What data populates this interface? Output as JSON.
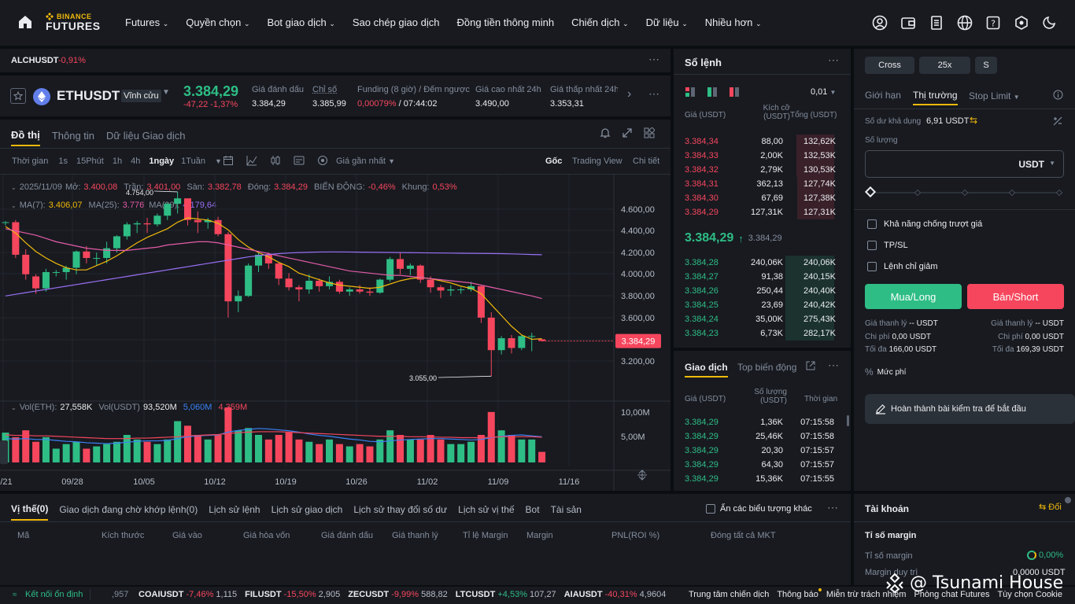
{
  "header": {
    "brand_top": "BINANCE",
    "brand_bottom": "FUTURES",
    "nav": [
      "Futures",
      "Quyền chọn",
      "Bot giao dịch",
      "Sao chép giao dịch",
      "Đồng tiền thông minh",
      "Chiến dịch",
      "Dữ liệu",
      "Nhiều hơn"
    ]
  },
  "ticker_strip": {
    "symbol": "ALCHUSDT",
    "change": "-0,91%"
  },
  "symbol_bar": {
    "symbol": "ETHUSDT",
    "type": "Vĩnh cửu",
    "price": "3.384,29",
    "change": "-47,22 -1,37%",
    "stats": [
      {
        "label": "Giá đánh dấu",
        "value": "3.384,29"
      },
      {
        "label": "Chỉ số",
        "value": "3.385,99"
      },
      {
        "label": "Funding (8 giờ) / Đếm ngược",
        "value_red": "0,00079%",
        "value_rest": " / 07:44:02"
      },
      {
        "label": "Giá cao nhất 24h",
        "value": "3.490,00"
      },
      {
        "label": "Giá thấp nhất 24h",
        "value": "3.353,31"
      }
    ]
  },
  "chart_tabs": [
    "Đồ thị",
    "Thông tin",
    "Dữ liệu Giao dịch"
  ],
  "chart_toolbar": {
    "time_label": "Thời gian",
    "intervals": [
      "1s",
      "15Phút",
      "1h",
      "4h",
      "1ngày",
      "1Tuần"
    ],
    "price_type": "Giá gần nhất",
    "views": [
      "Gốc",
      "Trading View",
      "Chi tiết"
    ]
  },
  "ohlc": {
    "date": "2025/11/09",
    "open_label": "Mở:",
    "open": "3.400,08",
    "high_label": "Trần:",
    "high": "3.401,00",
    "low_label": "Sàn:",
    "low": "3.382,78",
    "close_label": "Đóng:",
    "close": "3.384,29",
    "change_label": "BIẾN ĐỘNG:",
    "change": "-0,46%",
    "range_label": "Khung:",
    "range": "0,53%"
  },
  "ma": {
    "ma7_label": "MA(7):",
    "ma7": "3.406,07",
    "ma25_label": "MA(25):",
    "ma25": "3.776",
    "ma99_label": "MA(99):",
    "ma99": "4.179,64"
  },
  "vol": {
    "label": "Vol(ETH):",
    "eth": "27,558K",
    "usdt_label": "Vol(USDT)",
    "usdt": "93,520M",
    "v1": "5,060M",
    "v2": "4,359M"
  },
  "chart_data": {
    "type": "candlestick",
    "y_ticks": [
      "4.600,00",
      "4.400,00",
      "4.200,00",
      "4.000,00",
      "3.800,00",
      "3.600,00",
      "3.400,00",
      "3.200,00"
    ],
    "vol_ticks": [
      "10,00M",
      "5,00M"
    ],
    "x_ticks": [
      "/21",
      "09/28",
      "10/05",
      "10/12",
      "10/19",
      "10/26",
      "11/02",
      "11/09",
      "11/16"
    ],
    "last_price": "3.384,29",
    "high_marker": "4.754,00",
    "low_marker": "3.055,00",
    "candles": [
      [
        4480,
        4490,
        4450,
        4480
      ],
      [
        4480,
        4500,
        4150,
        4180
      ],
      [
        4180,
        4230,
        3950,
        4000
      ],
      [
        3980,
        4000,
        3820,
        3870
      ],
      [
        3870,
        4050,
        3840,
        4020
      ],
      [
        4020,
        4040,
        3980,
        4020
      ],
      [
        4020,
        4080,
        3950,
        4060
      ],
      [
        4060,
        4220,
        4000,
        4210
      ],
      [
        4210,
        4260,
        4100,
        4150
      ],
      [
        4150,
        4200,
        4080,
        4150
      ],
      [
        4150,
        4300,
        4100,
        4240
      ],
      [
        4240,
        4360,
        4200,
        4350
      ],
      [
        4350,
        4480,
        4320,
        4460
      ],
      [
        4460,
        4490,
        4380,
        4470
      ],
      [
        4470,
        4520,
        4380,
        4460
      ],
      [
        4460,
        4560,
        4440,
        4540
      ],
      [
        4540,
        4660,
        4500,
        4650
      ],
      [
        4650,
        4760,
        4560,
        4700
      ],
      [
        4700,
        4700,
        4450,
        4500
      ],
      [
        4500,
        4580,
        4380,
        4480
      ],
      [
        4480,
        4520,
        4420,
        4500
      ],
      [
        4500,
        4530,
        4350,
        4370
      ],
      [
        4370,
        4390,
        3600,
        3750
      ],
      [
        3750,
        3850,
        3650,
        3800
      ],
      [
        3800,
        4100,
        3790,
        4080
      ],
      [
        4080,
        4200,
        4020,
        4180
      ],
      [
        4180,
        4200,
        4050,
        4100
      ],
      [
        4100,
        4110,
        3900,
        3960
      ],
      [
        3960,
        4010,
        3850,
        3880
      ],
      [
        3880,
        3900,
        3750,
        3860
      ],
      [
        3860,
        4000,
        3820,
        3940
      ],
      [
        3940,
        3960,
        3840,
        3890
      ],
      [
        3890,
        3980,
        3860,
        3930
      ],
      [
        3930,
        3950,
        3820,
        3840
      ],
      [
        3840,
        3880,
        3800,
        3860
      ],
      [
        3860,
        3900,
        3820,
        3840
      ],
      [
        3840,
        3880,
        3800,
        3830
      ],
      [
        3830,
        3960,
        3820,
        3950
      ],
      [
        3950,
        4160,
        3930,
        4140
      ],
      [
        4140,
        4200,
        4000,
        4050
      ],
      [
        4050,
        4100,
        3990,
        4080
      ],
      [
        4080,
        4090,
        3920,
        3950
      ],
      [
        3950,
        3980,
        3830,
        3880
      ],
      [
        3880,
        3900,
        3780,
        3850
      ],
      [
        3850,
        3900,
        3800,
        3860
      ],
      [
        3860,
        3880,
        3820,
        3860
      ],
      [
        3860,
        3930,
        3840,
        3890
      ],
      [
        3890,
        3900,
        3550,
        3600
      ],
      [
        3600,
        3650,
        3060,
        3300
      ],
      [
        3300,
        3430,
        3260,
        3410
      ],
      [
        3410,
        3440,
        3270,
        3320
      ],
      [
        3320,
        3440,
        3300,
        3430
      ],
      [
        3430,
        3460,
        3290,
        3430
      ],
      [
        3400,
        3401,
        3383,
        3384
      ]
    ],
    "ma7": [
      4440,
      4380,
      4290,
      4210,
      4150,
      4100,
      4060,
      4040,
      4040,
      4080,
      4120,
      4170,
      4230,
      4290,
      4340,
      4380,
      4420,
      4480,
      4520,
      4510,
      4500,
      4470,
      4410,
      4320,
      4250,
      4200,
      4160,
      4110,
      4070,
      4010,
      3980,
      3950,
      3920,
      3900,
      3890,
      3880,
      3870,
      3880,
      3910,
      3940,
      3960,
      3970,
      3960,
      3940,
      3920,
      3890,
      3870,
      3820,
      3720,
      3620,
      3520,
      3440,
      3400,
      3406
    ],
    "ma25": [
      4420,
      4400,
      4380,
      4360,
      4330,
      4300,
      4280,
      4260,
      4240,
      4230,
      4220,
      4220,
      4220,
      4230,
      4240,
      4250,
      4270,
      4280,
      4290,
      4300,
      4300,
      4290,
      4270,
      4250,
      4230,
      4210,
      4190,
      4170,
      4150,
      4130,
      4110,
      4090,
      4070,
      4050,
      4030,
      4020,
      4010,
      4000,
      3990,
      3990,
      3980,
      3970,
      3960,
      3950,
      3940,
      3930,
      3920,
      3900,
      3880,
      3860,
      3840,
      3820,
      3800,
      3776
    ],
    "ma99": [
      3800,
      3815,
      3830,
      3845,
      3860,
      3875,
      3890,
      3905,
      3920,
      3935,
      3950,
      3965,
      3980,
      3995,
      4010,
      4025,
      4040,
      4055,
      4070,
      4085,
      4100,
      4115,
      4130,
      4145,
      4160,
      4172,
      4182,
      4190,
      4196,
      4200,
      4203,
      4205,
      4206,
      4206,
      4205,
      4204,
      4203,
      4202,
      4201,
      4200,
      4199,
      4198,
      4197,
      4196,
      4195,
      4194,
      4193,
      4192,
      4191,
      4190,
      4188,
      4185,
      4182,
      4180
    ],
    "volumes": [
      6.5,
      5.5,
      7,
      4.5,
      5.5,
      3,
      4,
      4.5,
      3,
      3.5,
      4,
      4.5,
      6,
      5,
      4.5,
      4,
      5,
      9,
      8,
      6,
      5,
      6,
      12,
      7,
      7.5,
      6,
      5,
      6,
      6.5,
      5,
      4.5,
      4,
      5,
      4,
      3.5,
      4,
      3.5,
      5,
      7,
      6,
      5,
      5,
      6,
      5,
      4,
      4,
      4.5,
      6,
      11,
      7,
      6,
      5,
      5,
      2.3
    ],
    "vol_ma": [
      5.2,
      5.1,
      5.2,
      5,
      5,
      4.8,
      4.6,
      4.5,
      4.3,
      4.2,
      4.1,
      4.2,
      4.4,
      4.6,
      4.7,
      4.7,
      4.8,
      5.2,
      5.6,
      5.8,
      5.9,
      6,
      6.6,
      7,
      7.2,
      7.4,
      7.3,
      7.1,
      6.9,
      6.6,
      6.2,
      5.9,
      5.7,
      5.4,
      5.1,
      4.9,
      4.6,
      4.5,
      4.7,
      4.9,
      5,
      5.1,
      5.2,
      5.2,
      5.1,
      5,
      4.9,
      5,
      5.4,
      5.7,
      5.9,
      6,
      5.8,
      5.6
    ],
    "vol_ma2": [
      6,
      5.9,
      5.9,
      5.8,
      5.8,
      5.7,
      5.6,
      5.5,
      5.4,
      5.3,
      5.2,
      5.2,
      5.2,
      5.3,
      5.3,
      5.4,
      5.5,
      5.6,
      5.8,
      5.9,
      6,
      6.1,
      6.3,
      6.5,
      6.6,
      6.7,
      6.7,
      6.7,
      6.6,
      6.5,
      6.4,
      6.3,
      6.2,
      6.1,
      6,
      5.9,
      5.8,
      5.7,
      5.7,
      5.7,
      5.6,
      5.6,
      5.6,
      5.5,
      5.5,
      5.4,
      5.4,
      5.4,
      5.5,
      5.6,
      5.6,
      5.6,
      5.6,
      5.5
    ]
  },
  "orderbook": {
    "title": "Sổ lệnh",
    "tick": "0,01",
    "h_price": "Giá (USDT)",
    "h_size": "Kích cỡ (USDT)",
    "h_total": "Tổng (USDT)",
    "asks": [
      [
        "3.384,34",
        "88,00",
        "132,62K",
        0.78
      ],
      [
        "3.384,33",
        "2,00K",
        "132,53K",
        0.78
      ],
      [
        "3.384,32",
        "2,79K",
        "130,53K",
        0.77
      ],
      [
        "3.384,31",
        "362,13",
        "127,74K",
        0.75
      ],
      [
        "3.384,30",
        "67,69",
        "127,38K",
        0.75
      ],
      [
        "3.384,29",
        "127,31K",
        "127,31K",
        0.75
      ]
    ],
    "mid_price": "3.384,29",
    "mark_price": "3.384,29",
    "bids": [
      [
        "3.384,28",
        "240,06K",
        "240,06K",
        1.0
      ],
      [
        "3.384,27",
        "91,38",
        "240,15K",
        1.0
      ],
      [
        "3.384,26",
        "250,44",
        "240,40K",
        1.0
      ],
      [
        "3.384,25",
        "23,69",
        "240,42K",
        1.0
      ],
      [
        "3.384,24",
        "35,00K",
        "275,43K",
        1.0
      ],
      [
        "3.384,23",
        "6,73K",
        "282,17K",
        1.0
      ]
    ]
  },
  "trades": {
    "tab1": "Giao dịch",
    "tab2": "Top biến động",
    "h_price": "Giá (USDT)",
    "h_qty": "Số lượng (USDT)",
    "h_time": "Thời gian",
    "rows": [
      [
        "3.384,29",
        "1,36K",
        "07:15:58"
      ],
      [
        "3.384,29",
        "25,46K",
        "07:15:58"
      ],
      [
        "3.384,29",
        "20,30",
        "07:15:57"
      ],
      [
        "3.384,29",
        "64,30",
        "07:15:57"
      ],
      [
        "3.384,29",
        "15,36K",
        "07:15:55"
      ]
    ]
  },
  "order_form": {
    "margin_mode": "Cross",
    "leverage": "25x",
    "asset_mode": "S",
    "tabs": [
      "Giới hạn",
      "Thị trường",
      "Stop Limit"
    ],
    "available_label": "Số dư khả dụng",
    "available": "6,91 USDT",
    "qty_label": "Số lượng",
    "qty_unit": "USDT",
    "checkboxes": [
      "Khả năng chống trượt giá",
      "TP/SL",
      "Lệnh chỉ giảm"
    ],
    "buy": "Mua/Long",
    "sell": "Bán/Short",
    "liq_label": "Giá thanh lý",
    "liq_value": "-- USDT",
    "cost_label": "Chi phí",
    "cost_value": "0,00 USDT",
    "max_label": "Tối đa",
    "max_buy": "166,00 USDT",
    "max_sell": "169,39 USDT",
    "fee": "Mức phí",
    "quiz": "Hoàn thành bài kiểm tra để bắt đầu"
  },
  "positions": {
    "tabs": [
      "Vị thế(0)",
      "Giao dịch đang chờ khớp lệnh(0)",
      "Lịch sử lệnh",
      "Lịch sử giao dịch",
      "Lịch sử thay đổi số dư",
      "Lịch sử vị thế",
      "Bot",
      "Tài sản"
    ],
    "hide_label": "Ẩn các biểu tượng khác",
    "columns": [
      "Mã",
      "Kích thước",
      "Giá vào",
      "Giá hòa vốn",
      "Giá đánh dấu",
      "Giá thanh lý",
      "Tỉ lệ Margin",
      "Margin",
      "PNL(ROI %)",
      "Đóng tất cả MKT"
    ]
  },
  "account": {
    "title": "Tài khoản",
    "switch": "Đổi",
    "margin_title": "Tỉ số margin",
    "margin_ratio_label": "Tỉ số margin",
    "margin_ratio": "0,00%",
    "maint_label": "Margin duy trì",
    "maint": "0,0000 USDT"
  },
  "statusbar": {
    "connection": "Kết nối ổn định",
    "first": ",957",
    "tickers": [
      {
        "sym": "COAIUSDT",
        "chg": "-7,46%",
        "p": "1,115",
        "up": false
      },
      {
        "sym": "FILUSDT",
        "chg": "-15,50%",
        "p": "2,905",
        "up": false
      },
      {
        "sym": "ZECUSDT",
        "chg": "-9,99%",
        "p": "588,82",
        "up": false
      },
      {
        "sym": "LTCUSDT",
        "chg": "+4,53%",
        "p": "107,27",
        "up": true
      },
      {
        "sym": "AIAUSDT",
        "chg": "-40,31%",
        "p": "4,9604",
        "up": false
      }
    ],
    "links": [
      "Trung tâm chiến dịch",
      "Thông báo",
      "Miễn trừ trách nhiệm",
      "Phòng chat Futures",
      "Tùy chọn Cookie"
    ]
  },
  "watermark": "@ Tsunami House",
  "colors": {
    "green": "#2ebd85",
    "red": "#f6465d",
    "accent": "#f0b90b",
    "bg": "#0b0e11",
    "panel": "#181a20"
  }
}
